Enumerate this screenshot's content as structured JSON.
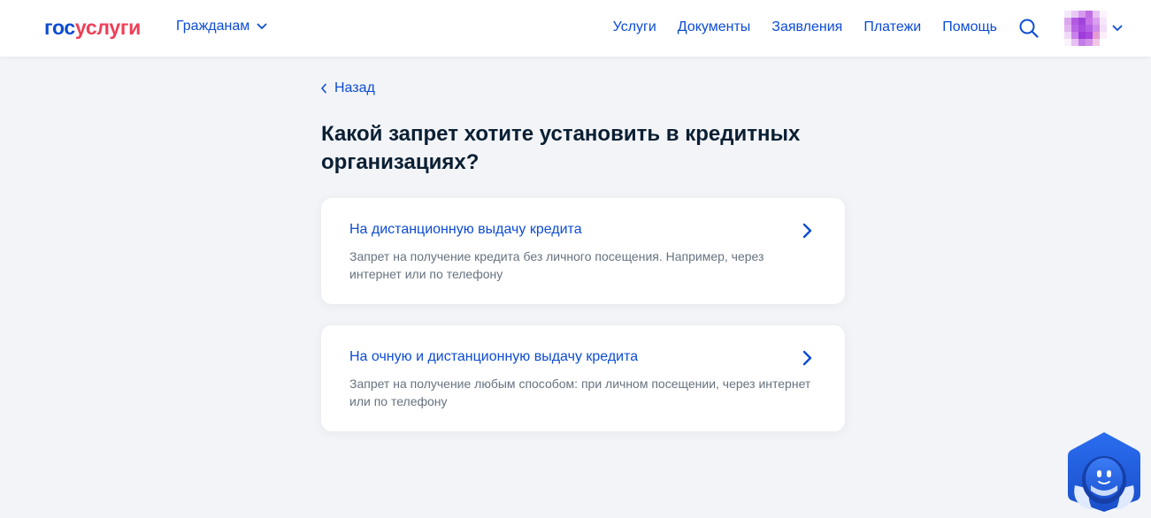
{
  "header": {
    "logo": {
      "gos": "гос",
      "uslugi": "услуги"
    },
    "audience_label": "Гражданам",
    "nav": [
      "Услуги",
      "Документы",
      "Заявления",
      "Платежи",
      "Помощь"
    ]
  },
  "back_label": "Назад",
  "title": "Какой запрет хотите установить в кредитных организациях?",
  "options": [
    {
      "title": "На дистанционную выдачу кредита",
      "description": "Запрет на получение кредита без личного посещения. Например, через интернет или по телефону"
    },
    {
      "title": "На очную и дистанционную выдачу кредита",
      "description": "Запрет на получение любым способом: при личном посещении, через интернет или по телефону"
    }
  ],
  "colors": {
    "brand_blue": "#0d4cd3",
    "brand_red": "#ee3f58",
    "background": "#f2f4f8",
    "text_primary": "#0b1f33",
    "text_secondary": "#66727f"
  },
  "icons": {
    "audience": "chevron-down-icon",
    "search": "search-icon",
    "profile": "chevron-down-icon",
    "back": "chevron-left-icon",
    "option": "chevron-right-icon",
    "assistant": "robot-assistant-icon"
  }
}
